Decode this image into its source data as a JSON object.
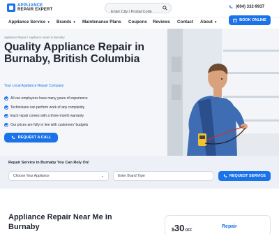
{
  "header": {
    "logo_line1": "APPLIANCE",
    "logo_line2": "REPAIR EXPERT",
    "search_placeholder": "Enter City / Postal Code",
    "phone": "(604) 332-9937",
    "book_label": "BOOK ONLINE"
  },
  "nav": {
    "items": [
      {
        "label": "Appliance Service",
        "has_dropdown": true
      },
      {
        "label": "Brands",
        "has_dropdown": true
      },
      {
        "label": "Maintenance Plans",
        "has_dropdown": false
      },
      {
        "label": "Coupons",
        "has_dropdown": false
      },
      {
        "label": "Reviews",
        "has_dropdown": false
      },
      {
        "label": "Contact",
        "has_dropdown": false
      },
      {
        "label": "About",
        "has_dropdown": true
      }
    ]
  },
  "hero": {
    "breadcrumb": "Appliance Repair / Appliance repair in Burnaby",
    "title": "Quality Appliance Repair in Burnaby, British Columbia",
    "subtitle": "Your Local Appliance Repair Company",
    "features": [
      "All our employees have many years of experience",
      "Technicians can perform work of any complexity",
      "Each repair comes with a three-month warranty",
      "Our prices are fully in line with customers' budgets"
    ],
    "cta_label": "REQUEST A CALL"
  },
  "service_form": {
    "title": "Repair Service in Burnaby You Can Rely On!",
    "appliance_select": "Choose Your Appliance",
    "brand_placeholder": "Enter Brand Type",
    "submit_label": "REQUEST SERVICE"
  },
  "near_me": {
    "title": "Appliance Repair Near Me in Burnaby"
  },
  "coupon": {
    "dollar": "$",
    "amount": "30",
    "off": "OFF",
    "label": "Repair"
  },
  "colors": {
    "accent": "#1a73e8",
    "text": "#1f2430",
    "hero_bg": "#f4f6f9"
  }
}
